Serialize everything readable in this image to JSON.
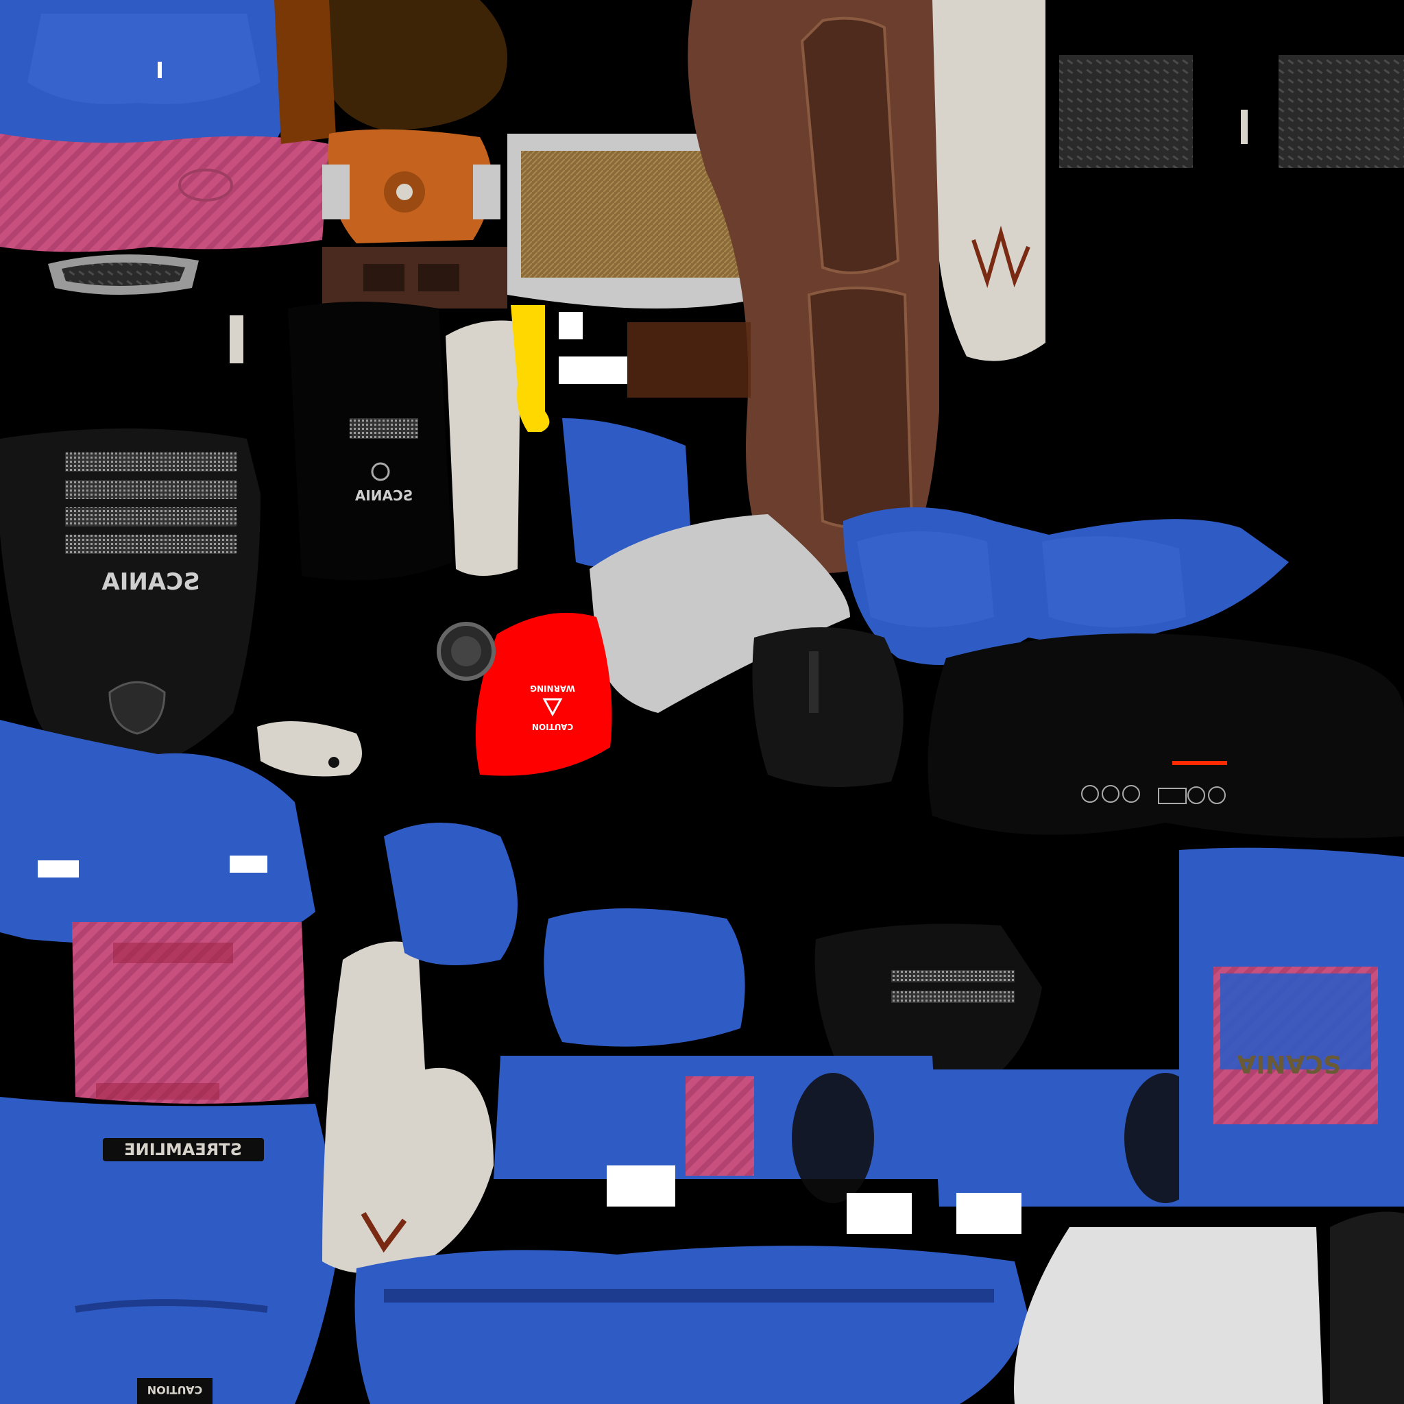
{
  "atlas": {
    "colors": {
      "background": "#000000",
      "paint_blue": "#2f5bc4",
      "paint_blue_dark": "#1d3c8f",
      "paint_pink": "#c8507e",
      "leather_brown": "#6b3e2e",
      "rust_orange": "#c5621e",
      "cream": "#d8d4cc",
      "warning_red": "#ff0000",
      "signal_yellow": "#ffd800",
      "grey": "#c9c9c9",
      "plate_dark": "#2a2a2a"
    },
    "labels": {
      "grille_brand": "SCANIA",
      "panel_brand": "SCANIA",
      "side_brand": "SCANIA",
      "streamline": "STREAMLINE",
      "caution_plate": "CAUTION",
      "warning_top": "WARNING",
      "warning_bottom": "CAUTION"
    }
  }
}
